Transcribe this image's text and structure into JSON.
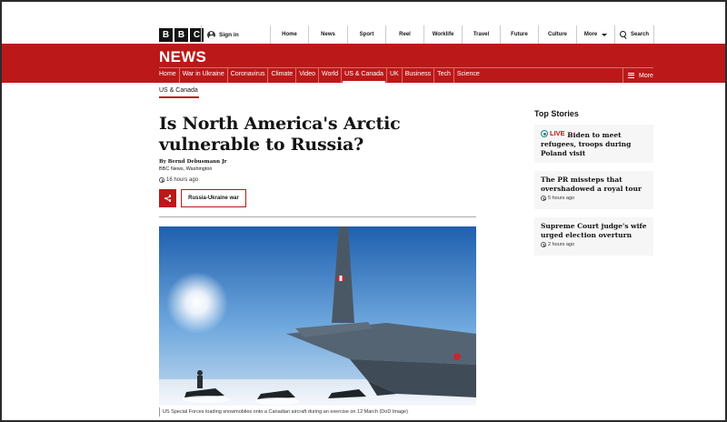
{
  "brand": {
    "letters": [
      "B",
      "B",
      "C"
    ]
  },
  "account": {
    "sign_in": "Sign in"
  },
  "top_nav": [
    "Home",
    "News",
    "Sport",
    "Reel",
    "Worklife",
    "Travel",
    "Future",
    "Culture",
    "More",
    "Search"
  ],
  "section_title": "NEWS",
  "sub_nav": [
    "Home",
    "War in Ukraine",
    "Coronavirus",
    "Climate",
    "Video",
    "World",
    "US & Canada",
    "UK",
    "Business",
    "Tech",
    "Science"
  ],
  "sub_nav_active": "US & Canada",
  "sub_nav_more": "More",
  "breadcrumb": "US & Canada",
  "article": {
    "headline": "Is North America's Arctic vulnerable to Russia?",
    "author": "By Bernd Debusmann Jr",
    "outlet": "BBC News, Washington",
    "timestamp": "16 hours ago",
    "tag": "Russia-Ukraine war",
    "image_caption": "US Special Forces loading snowmobiles onto a Canadian aircraft during an exercise on 12 March (DoD Image)"
  },
  "top_stories": {
    "title": "Top Stories",
    "items": [
      {
        "live_label": "LIVE",
        "headline": "Biden to meet refugees, troops during Poland visit",
        "time": ""
      },
      {
        "live_label": "",
        "headline": "The PR missteps that overshadowed a royal tour",
        "time": "5 hours ago"
      },
      {
        "live_label": "",
        "headline": "Supreme Court judge's wife urged election overturn",
        "time": "2 hours ago"
      }
    ]
  },
  "colors": {
    "brand_red": "#bb1919",
    "live_teal": "#1a8a8a"
  },
  "icons": [
    "avatar-icon",
    "chevron-down-icon",
    "search-icon",
    "menu-icon",
    "clock-icon",
    "share-icon",
    "live-icon"
  ]
}
